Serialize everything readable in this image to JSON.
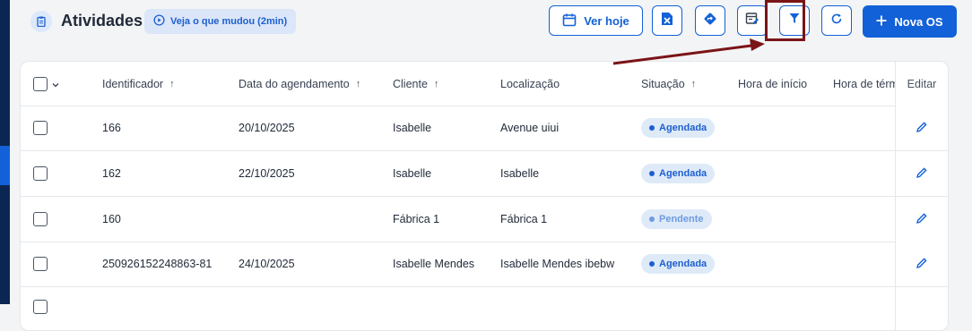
{
  "header": {
    "title": "Atividades",
    "whats_new": "Veja o que mudou (2min)",
    "ver_hoje": "Ver hoje",
    "nova_os": "Nova OS"
  },
  "table": {
    "columns": [
      "Identificador",
      "Data do agendamento",
      "Cliente",
      "Localização",
      "Situação",
      "Hora de início",
      "Hora de términ",
      "Editar"
    ],
    "rows": [
      {
        "id": "166",
        "date": "20/10/2025",
        "client": "Isabelle",
        "location": "Avenue uiui",
        "status": "Agendada"
      },
      {
        "id": "162",
        "date": "22/10/2025",
        "client": "Isabelle",
        "location": "Isabelle",
        "status": "Agendada"
      },
      {
        "id": "160",
        "date": "",
        "client": "Fábrica 1",
        "location": "Fábrica 1",
        "status": "Pendente"
      },
      {
        "id": "250926152248863-81",
        "date": "24/10/2025",
        "client": "Isabelle Mendes",
        "location": "Isabelle Mendes ibebw",
        "status": "Agendada"
      }
    ]
  },
  "colors": {
    "primary": "#1261d8",
    "sidebar": "#0b2650",
    "annotation": "#7a1416",
    "badge_bg": "#dfeaf8"
  },
  "icons": [
    "clipboard-icon",
    "play-circle-icon",
    "calendar-icon",
    "excel-icon",
    "route-icon",
    "edit-table-icon",
    "filter-icon",
    "refresh-icon",
    "plus-icon",
    "pencil-icon",
    "chevron-down-icon",
    "arrow-up-icon"
  ]
}
